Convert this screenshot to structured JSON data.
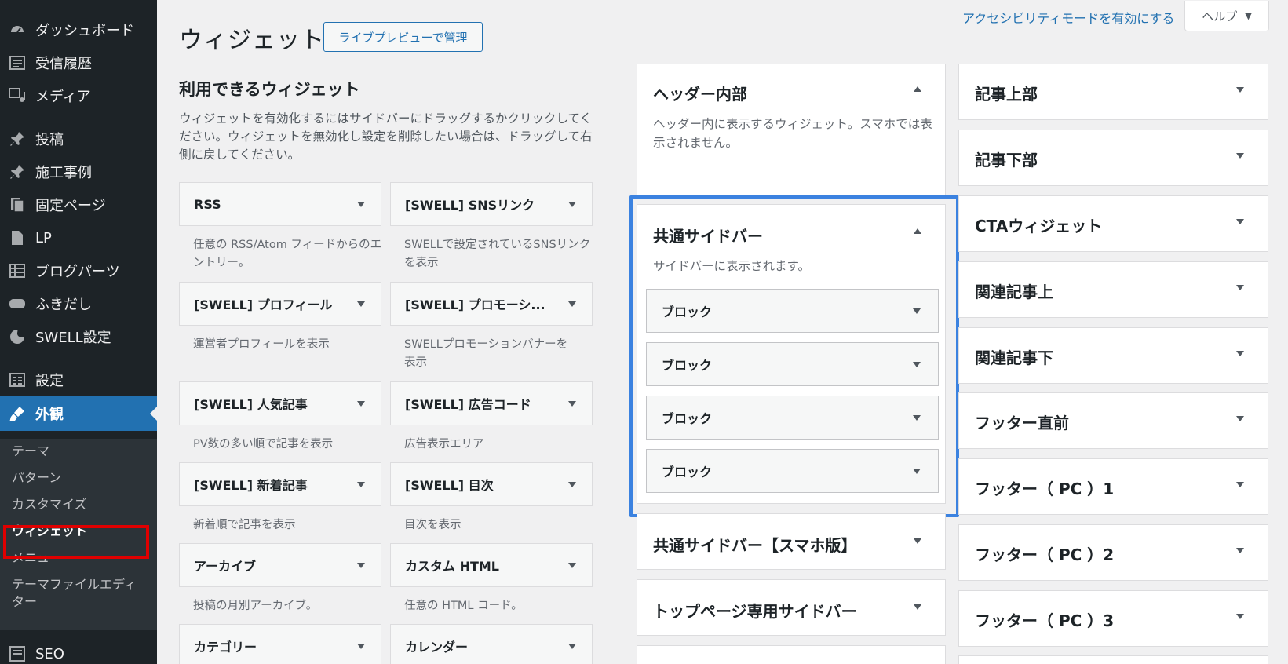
{
  "sidebar": {
    "menu": [
      {
        "label": "ダッシュボード",
        "icon": "dashboard-icon"
      },
      {
        "label": "受信履歴",
        "icon": "inbox-icon"
      },
      {
        "label": "メディア",
        "icon": "media-icon"
      },
      {
        "label": "投稿",
        "icon": "pin-icon"
      },
      {
        "label": "施工事例",
        "icon": "pin-icon"
      },
      {
        "label": "固定ページ",
        "icon": "pages-icon"
      },
      {
        "label": "LP",
        "icon": "document-icon"
      },
      {
        "label": "ブログパーツ",
        "icon": "grid-icon"
      },
      {
        "label": "ふきだし",
        "icon": "bubble-icon"
      },
      {
        "label": "SWELL設定",
        "icon": "swell-icon"
      },
      {
        "label": "設定",
        "icon": "settings-icon"
      },
      {
        "label": "外観",
        "icon": "paintbrush-icon"
      }
    ],
    "submenu": [
      "テーマ",
      "パターン",
      "カスタマイズ",
      "ウィジェット",
      "メニュー",
      "テーマファイルエディター"
    ],
    "seo": {
      "label": "SEO",
      "icon": "seo-icon"
    }
  },
  "header": {
    "title": "ウィジェット",
    "live_preview": "ライブプレビューで管理",
    "accessibility_link": "アクセシビリティモードを有効にする",
    "help": "ヘルプ"
  },
  "available": {
    "heading": "利用できるウィジェット",
    "description": "ウィジェットを有効化するにはサイドバーにドラッグするかクリックしてください。ウィジェットを無効化し設定を削除したい場合は、ドラッグして右側に戻してください。",
    "widgets": [
      {
        "title": "RSS",
        "desc": "任意の RSS/Atom フィードからのエントリー。"
      },
      {
        "title": "[SWELL] SNSリンク",
        "desc": "SWELLで設定されているSNSリンクを表示"
      },
      {
        "title": "[SWELL] プロフィール",
        "desc": "運営者プロフィールを表示"
      },
      {
        "title": "[SWELL] プロモーシ...",
        "desc": "SWELLプロモーションバナーを表示"
      },
      {
        "title": "[SWELL] 人気記事",
        "desc": "PV数の多い順で記事を表示"
      },
      {
        "title": "[SWELL] 広告コード",
        "desc": "広告表示エリア"
      },
      {
        "title": "[SWELL] 新着記事",
        "desc": "新着順で記事を表示"
      },
      {
        "title": "[SWELL] 目次",
        "desc": "目次を表示"
      },
      {
        "title": "アーカイブ",
        "desc": "投稿の月別アーカイブ。"
      },
      {
        "title": "カスタム HTML",
        "desc": "任意の HTML コード。"
      },
      {
        "title": "カテゴリー",
        "desc": ""
      },
      {
        "title": "カレンダー",
        "desc": ""
      }
    ]
  },
  "areas_col1": {
    "header_inner": {
      "title": "ヘッダー内部",
      "desc": "ヘッダー内に表示するウィジェット。スマホでは表示されません。"
    },
    "common_sidebar": {
      "title": "共通サイドバー",
      "desc": "サイドバーに表示されます。",
      "blocks": [
        "ブロック",
        "ブロック",
        "ブロック",
        "ブロック"
      ]
    },
    "common_sidebar_sp": {
      "title": "共通サイドバー【スマホ版】"
    },
    "top_sidebar": {
      "title": "トップページ専用サイドバー"
    }
  },
  "areas_col2": [
    "記事上部",
    "記事下部",
    "CTAウィジェット",
    "関連記事上",
    "関連記事下",
    "フッター直前",
    "フッター（ PC ）1",
    "フッター（ PC ）2",
    "フッター（ PC ）3"
  ],
  "colors": {
    "accent": "#2271b1",
    "sidebar_bg": "#1d2327",
    "highlight_red": "#e00000",
    "highlight_blue": "#3b82e0"
  }
}
